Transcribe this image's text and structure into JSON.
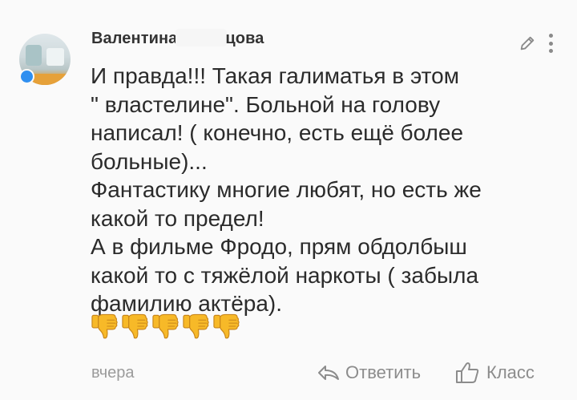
{
  "comment": {
    "author_first": "Валентина",
    "author_last": "цова",
    "text_lines": [
      "И правда!!! Такая галиматья в этом",
      "\" властелине\". Больной на голову",
      "написал! ( конечно, есть ещё более",
      "больные)...",
      "Фантастику многие любят, но есть же",
      "какой то предел!",
      "А в фильме Фродо, прям обдолбыш",
      "какой то с тяжёлой наркоты ( забыла",
      "фамилию актёра)."
    ],
    "emojis": [
      "thumbs-down",
      "thumbs-down",
      "thumbs-down",
      "thumbs-down",
      "thumbs-down"
    ],
    "time": "вчера",
    "reply_label": "Ответить",
    "like_label": "Класс"
  },
  "colors": {
    "online_dot": "#2f8ff0",
    "text": "#2b2b2b",
    "muted": "#8c8c8c",
    "emoji": "#f7b928"
  },
  "icons": {
    "edit": "pencil-icon",
    "more": "kebab-menu-icon",
    "reply": "reply-arrow-icon",
    "like": "thumbs-up-outline-icon"
  }
}
